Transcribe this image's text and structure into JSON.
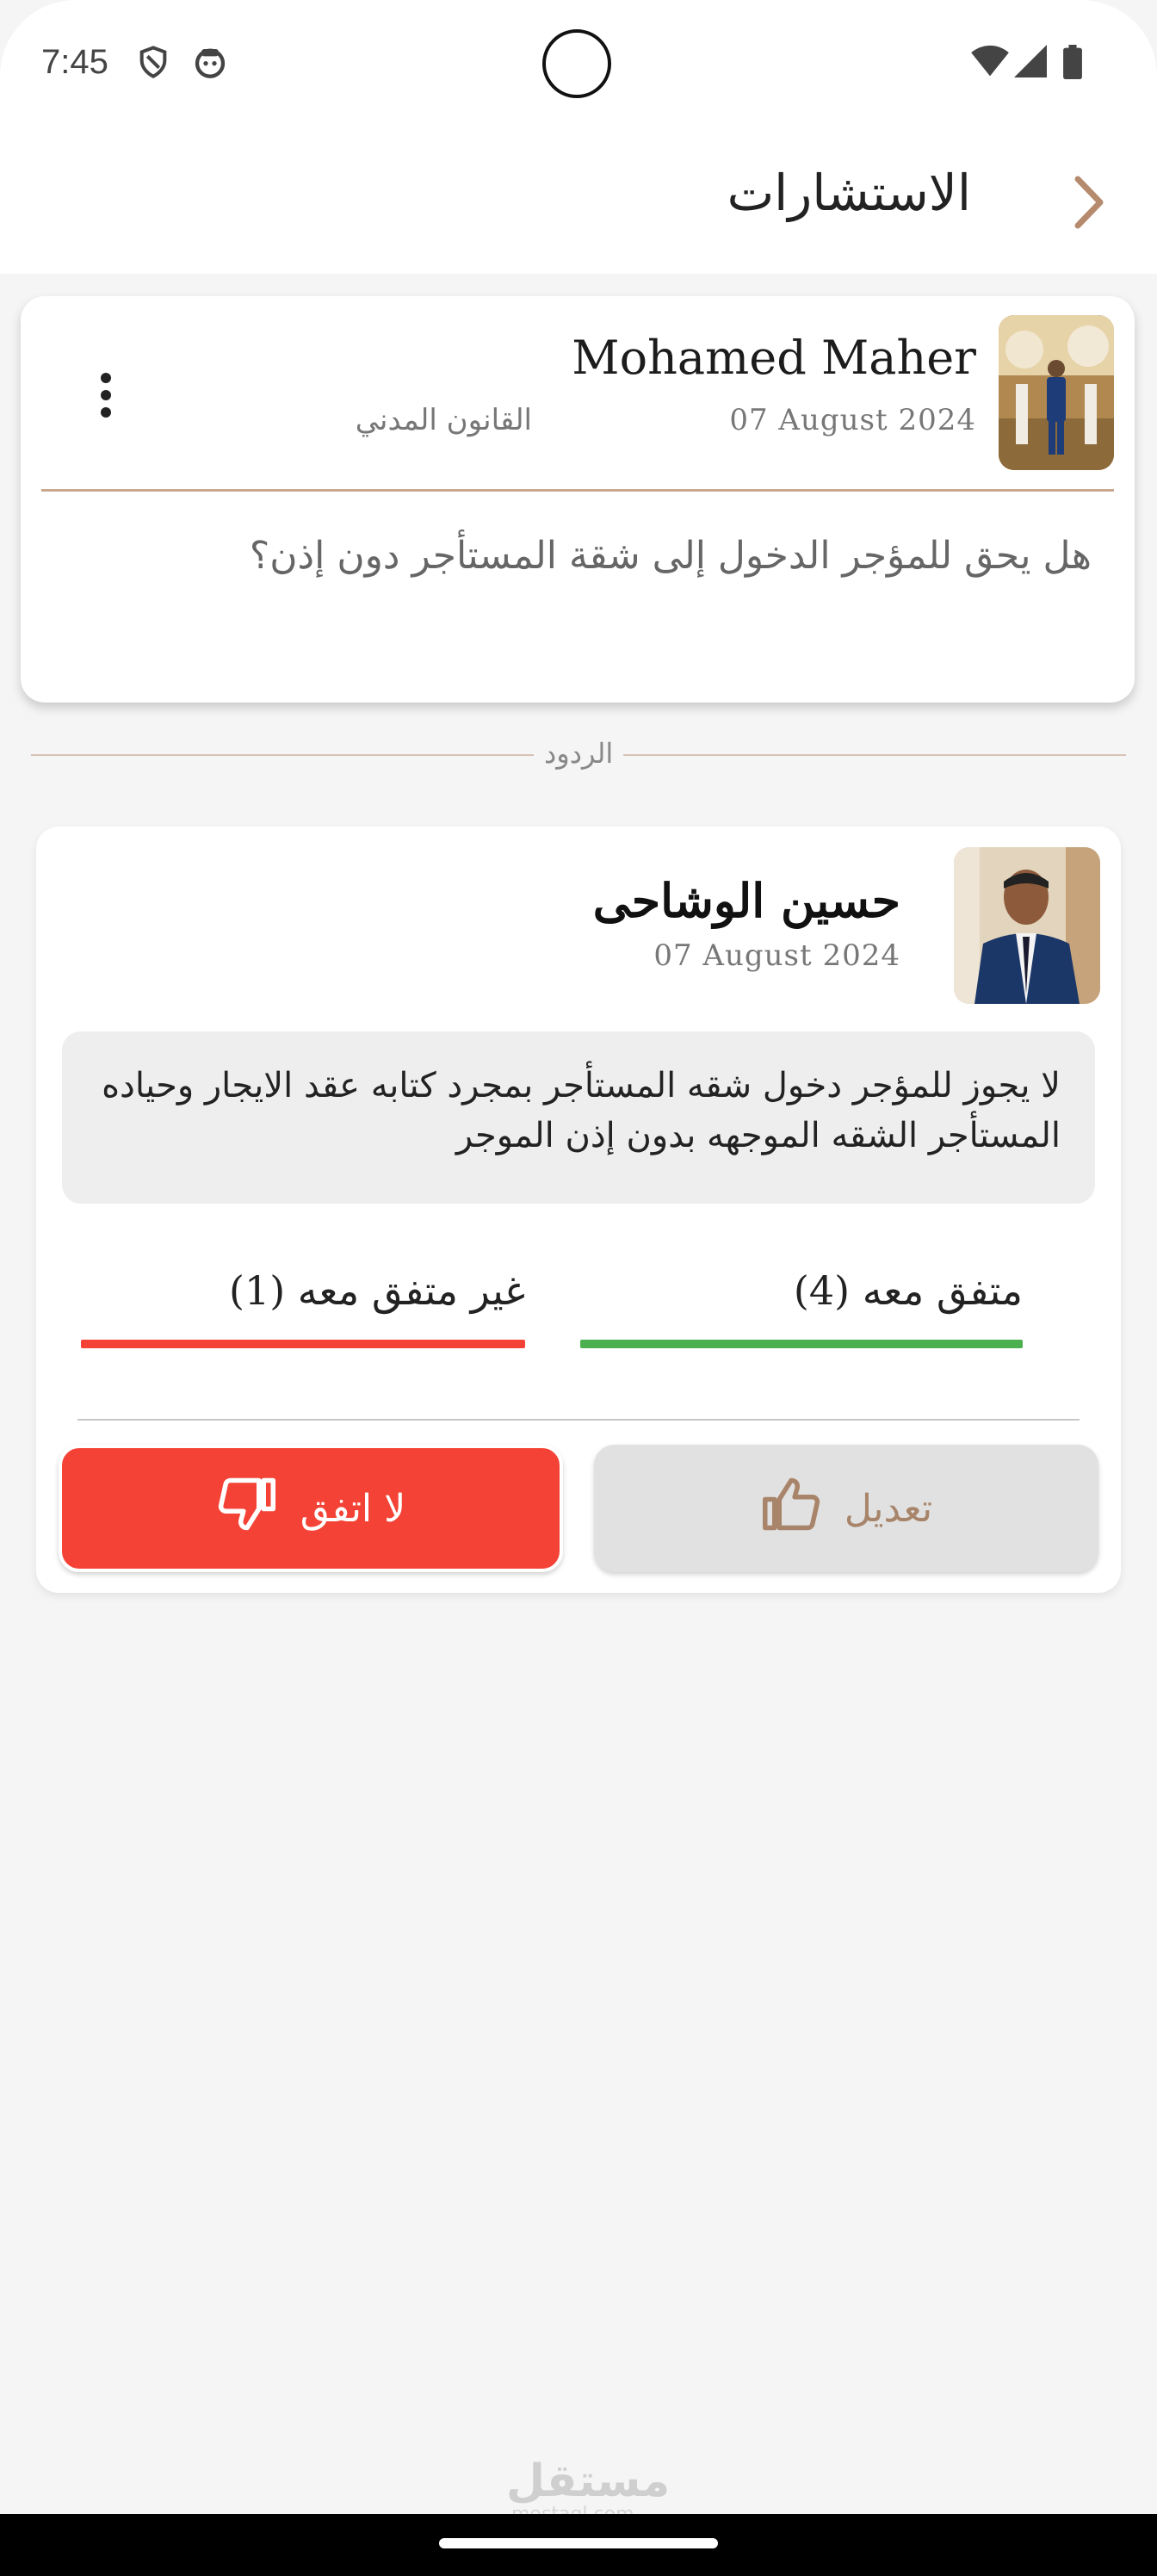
{
  "status_bar": {
    "time": "7:45"
  },
  "app_bar": {
    "title": "الاستشارات"
  },
  "question": {
    "author": "Mohamed Maher",
    "date": "07 August 2024",
    "category": "القانون المدني",
    "text": "هل يحق للمؤجر الدخول إلى شقة المستأجر دون إذن؟"
  },
  "replies_label": "الردود",
  "reply": {
    "author": "حسين  الوشاحى",
    "date": "07 August 2024",
    "text": "لا يجوز للمؤجر دخول شقه المستأجر بمجرد كتابه عقد الايجار وحياده المستأجر الشقه الموجهه بدون إذن الموجر",
    "agree_label": "متفق معه (4)",
    "disagree_label": "غير متفق معه (1)",
    "agree_count": 4,
    "disagree_count": 1,
    "edit_button": "تعديل",
    "disagree_button": "لا اتفق"
  },
  "colors": {
    "agree": "#4caf50",
    "disagree": "#f44336",
    "accent": "#a8856a"
  },
  "watermark": {
    "text": "مستقل",
    "sub": "mostaql.com"
  }
}
